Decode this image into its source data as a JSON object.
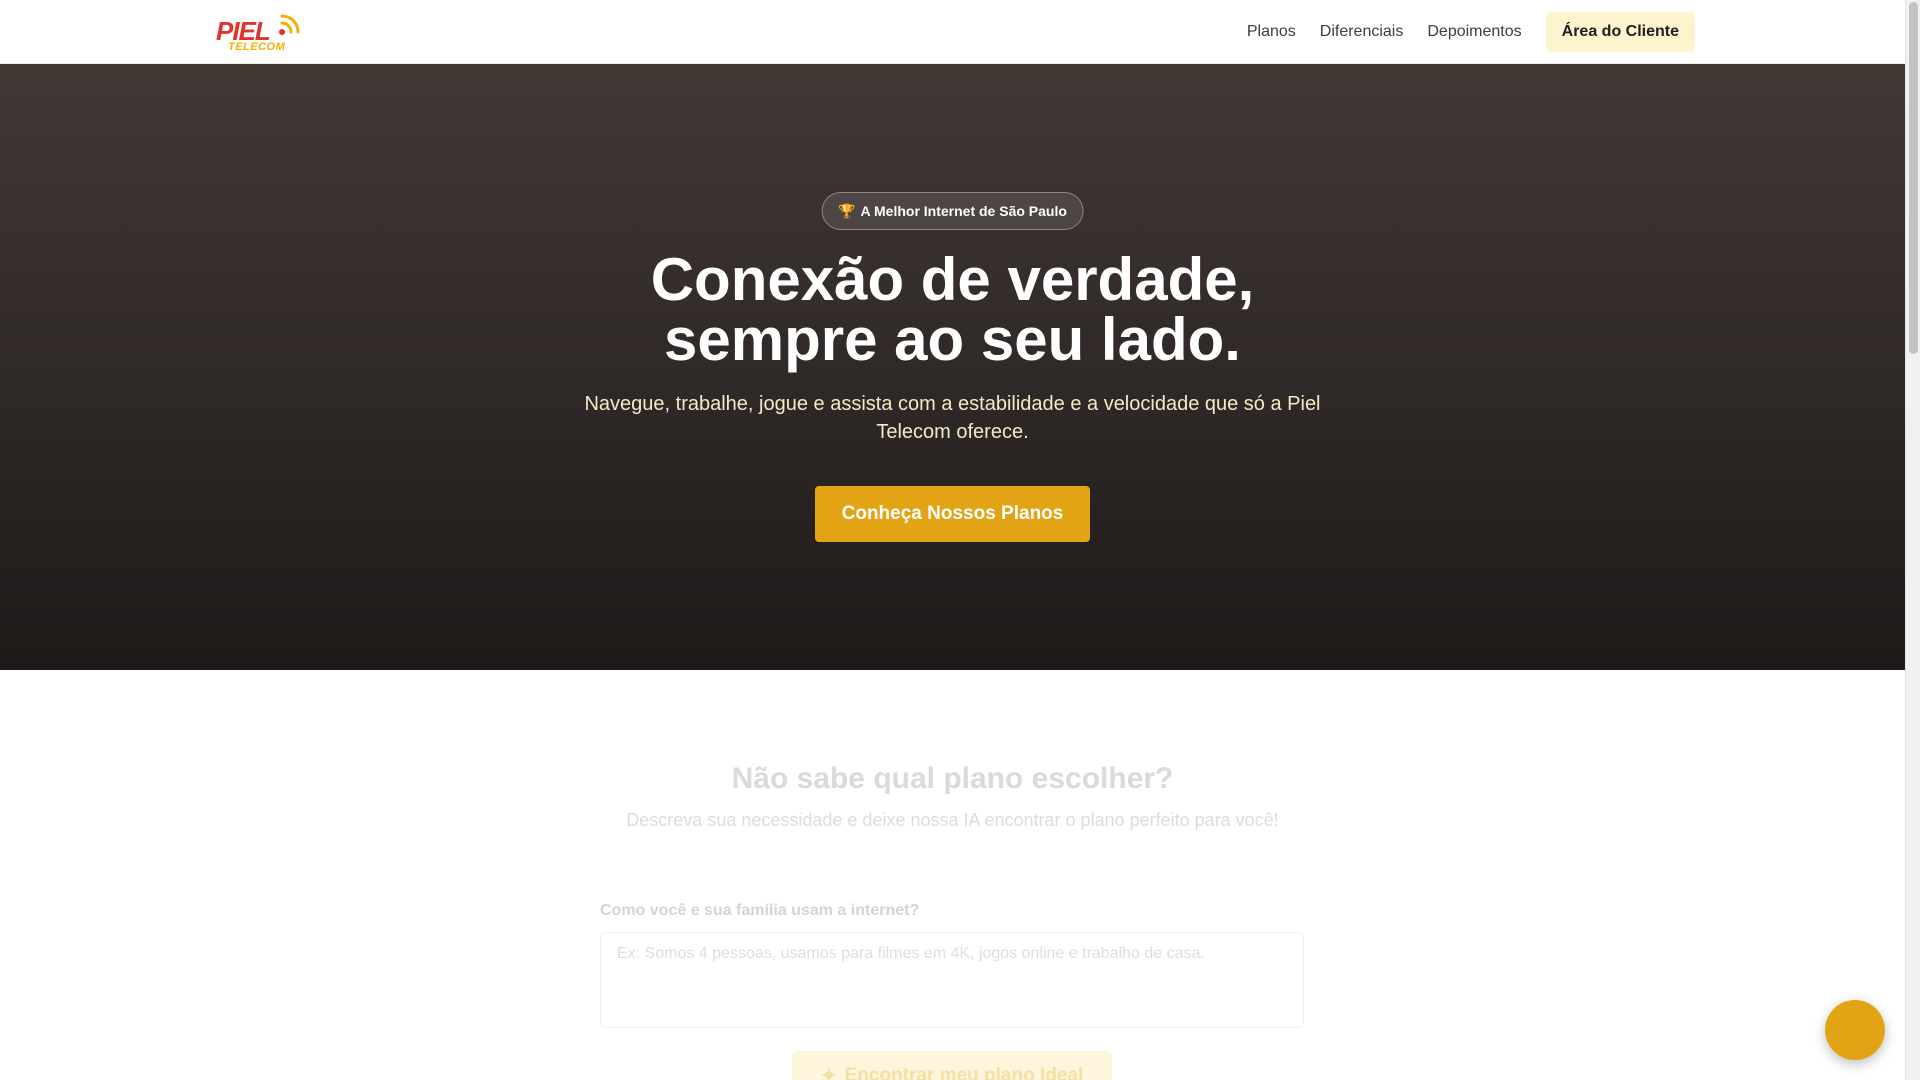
{
  "header": {
    "logo": {
      "main": "PIEL",
      "sub": "TELECOM",
      "icon": "wifi-signal-icon"
    },
    "nav": [
      {
        "label": "Planos"
      },
      {
        "label": "Diferenciais"
      },
      {
        "label": "Depoimentos"
      }
    ],
    "client_button": "Área do Cliente"
  },
  "hero": {
    "badge_icon": "🏆",
    "badge": "A Melhor Internet de São Paulo",
    "title_line1": "Conexão de verdade,",
    "title_line2": "sempre ao seu lado.",
    "subtitle": "Navegue, trabalhe, jogue e assista com a estabilidade e a velocidade que só a Piel Telecom oferece.",
    "cta": "Conheça Nossos Planos"
  },
  "ai_finder": {
    "title": "Não sabe qual plano escolher?",
    "subtitle": "Descreva sua necessidade e deixe nossa IA encontrar o plano perfeito para você!",
    "field_label": "Como você e sua família usam a internet?",
    "placeholder": "Ex: Somos 4 pessoas, usamos para filmes em 4K, jogos online e trabalho de casa.",
    "button_icon": "✦",
    "button": "Encontrar meu plano Ideal"
  },
  "colors": {
    "brand_red": "#e0332b",
    "brand_yellow": "#e2a415",
    "hero_dark": "#2e2826"
  }
}
